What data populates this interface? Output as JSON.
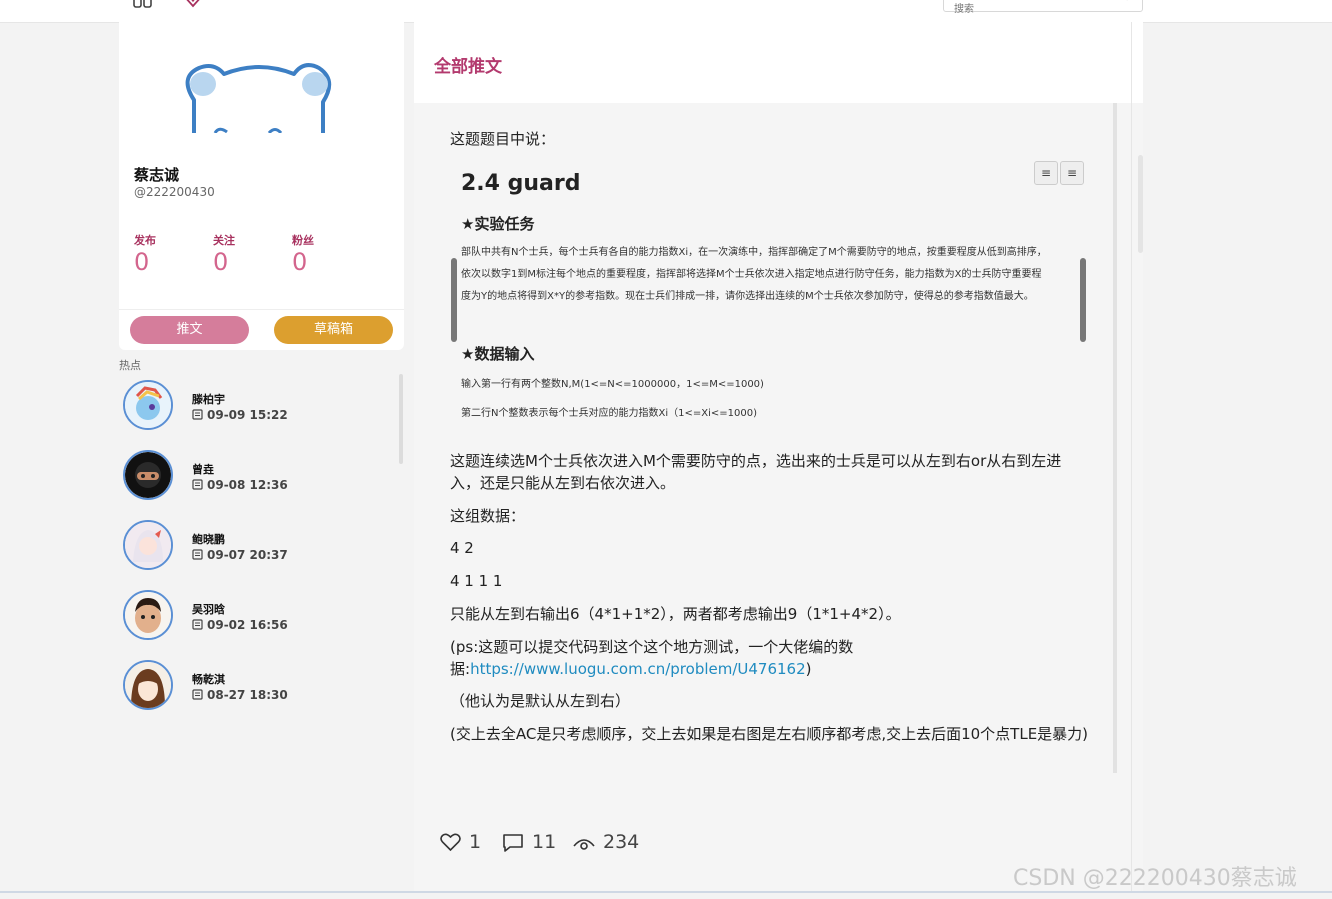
{
  "search": {
    "placeholder": "搜索"
  },
  "profile": {
    "name": "蔡志诚",
    "handle": "@222200430",
    "stats": [
      {
        "label": "发布",
        "value": "0"
      },
      {
        "label": "关注",
        "value": "0"
      },
      {
        "label": "粉丝",
        "value": "0"
      }
    ],
    "post_button": "推文",
    "draft_button": "草稿箱"
  },
  "hot": {
    "title": "热点",
    "items": [
      {
        "name": "滕柏宇",
        "time": "09-09 15:22"
      },
      {
        "name": "曾垚",
        "time": "09-08 12:36"
      },
      {
        "name": "鲍晓鹏",
        "time": "09-07 20:37"
      },
      {
        "name": "吴羽晗",
        "time": "09-02 16:56"
      },
      {
        "name": "畅乾淇",
        "time": "08-27 18:30"
      }
    ]
  },
  "main": {
    "title": "全部推文",
    "intro": "这题题目中说：",
    "doc_image": {
      "heading": "2.4 guard",
      "section1": "★实验任务",
      "body": "部队中共有N个士兵，每个士兵有各自的能力指数Xi，在一次演练中，指挥部确定了M个需要防守的地点，按重要程度从低到高排序，依次以数字1到M标注每个地点的重要程度，指挥部将选择M个士兵依次进入指定地点进行防守任务，能力指数为X的士兵防守重要程度为Y的地点将得到X*Y的参考指数。现在士兵们排成一排，请你选择出连续的M个士兵依次参加防守，使得总的参考指数值最大。",
      "section2": "★数据输入",
      "input1": "输入第一行有两个整数N,M(1<=N<=1000000，1<=M<=1000)",
      "input2": "第二行N个整数表示每个士兵对应的能力指数Xi（1<=Xi<=1000)"
    },
    "para1": " 这题连续选M个士兵依次进入M个需要防守的点，选出来的士兵是可以从左到右or从右到左进入，还是只能从左到右依次进入。",
    "para2": "这组数据：",
    "para3": "4 2",
    "para4": "4 1 1 1",
    "para5": "只能从左到右输出6（4*1+1*2），两者都考虑输出9（1*1+4*2）。",
    "para6_prefix": "(ps:这题可以提交代码到这个这个地方测试，一个大佬编的数据:",
    "para6_link": "https://www.luogu.com.cn/problem/U476162",
    "para6_suffix": ")",
    "para7": "（他认为是默认从左到右）",
    "para8": "(交上去全AC是只考虑顺序，交上去如果是右图是左右顺序都考虑,交上去后面10个点TLE是暴力)"
  },
  "actions": {
    "likes": "1",
    "comments": "11",
    "views": "234"
  },
  "watermark": "CSDN @222200430蔡志诚"
}
